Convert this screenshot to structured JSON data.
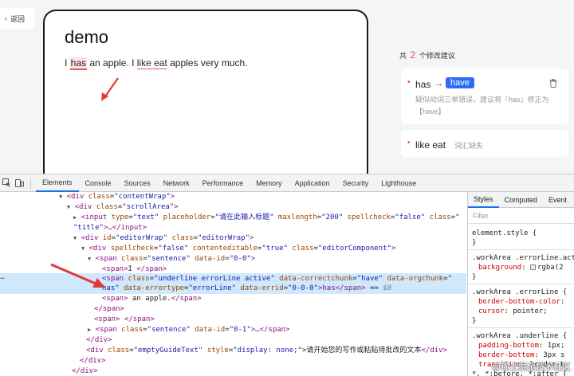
{
  "app": {
    "back_label": "返回",
    "editor_title": "demo",
    "text": {
      "pre": "I ",
      "has": "has",
      "mid": " an apple. I ",
      "like_eat": "like eat",
      "post": " apples very much."
    }
  },
  "suggestions": {
    "count_pre": "共",
    "count_num": "2",
    "count_post": "个修改建议",
    "items": [
      {
        "word": "has",
        "arrow": "→",
        "replacement": "have",
        "desc": "疑似动词三单错误，建议将『has』修正为【have】"
      },
      {
        "word": "like eat",
        "note": "词汇缺失"
      }
    ]
  },
  "devtools": {
    "tabs": [
      "Elements",
      "Console",
      "Sources",
      "Network",
      "Performance",
      "Memory",
      "Application",
      "Security",
      "Lighthouse"
    ],
    "active_tab": "Elements",
    "styles_tabs": [
      "Styles",
      "Computed",
      "Event"
    ],
    "filter_placeholder": "Filter",
    "dom": {
      "l1": {
        "open": "<div ",
        "a1": "class",
        "v1": "\"contentWrap\"",
        "close": ">"
      },
      "l2": {
        "open": "<div ",
        "a1": "class",
        "v1": "\"scrollArea\"",
        "close": ">"
      },
      "l3": {
        "open": "<input ",
        "a1": "type",
        "v1": "\"text\"",
        "a2": "placeholder",
        "v2": "\"请在此输入标题\"",
        "a3": "maxlength",
        "v3": "\"200\"",
        "a4": "spellcheck",
        "v4": "\"false\"",
        "a5": "class",
        "v5": "\""
      },
      "l4": {
        "v": "\"title\"",
        "close": ">…</input>"
      },
      "l5": {
        "open": "<div ",
        "a1": "id",
        "v1": "\"editorWrap\"",
        "a2": "class",
        "v2": "\"editorWrap\"",
        "close": ">"
      },
      "l6": {
        "open": "<div ",
        "a1": "spellcheck",
        "v1": "\"false\"",
        "a2": "contenteditable",
        "v2": "\"true\"",
        "a3": "class",
        "v3": "\"editorComponent\"",
        "close": ">"
      },
      "l7": {
        "open": "<span ",
        "a1": "class",
        "v1": "\"sentence\"",
        "a2": "data-id",
        "v2": "\"0-0\"",
        "close": ">"
      },
      "l8": {
        "open": "<span>",
        "text": "I ",
        "close": "</span>"
      },
      "l9": {
        "open": "<span ",
        "a1": "class",
        "v1": "\"underline errorLine active\"",
        "a2": "data-correctchunk",
        "v2": "\"have\"",
        "a3": "data-orgchunk",
        "v3": "\""
      },
      "l10": {
        "v": "has\"",
        "a1": "data-errortype",
        "v1": "\"errorLine\"",
        "a2": "data-errid",
        "v2": "\"0-0-0\"",
        "close": ">has</span>",
        "eq": " == ",
        "dollar": "$0"
      },
      "l11": {
        "open": "<span>",
        "text": " an apple.",
        "close": "</span>"
      },
      "l12": {
        "close": "</span>"
      },
      "l13": {
        "close": "<span> </span>"
      },
      "l14": {
        "open": "<span ",
        "a1": "class",
        "v1": "\"sentence\"",
        "a2": "data-id",
        "v2": "\"0-1\"",
        "close": ">…</span>"
      },
      "l15": {
        "close": "</div>"
      },
      "l16": {
        "open": "<div ",
        "a1": "class",
        "v1": "\"emptyGuideText\"",
        "a2": "style",
        "v2": "\"display: none;\"",
        "text": ">请开始您的写作或粘贴待批改的文本",
        "close": "</div>"
      },
      "l17": {
        "close": "</div>"
      },
      "l18": {
        "close": "</div>"
      }
    },
    "styles": {
      "s1": "element.style {",
      "s2": "}",
      "s3": ".workArea .errorLine.act",
      "s4p": "background",
      "s4v": "rgba(2",
      "s5": "}",
      "s6": ".workArea .errorLine {",
      "s7p": "border-bottom-color",
      "s7v": "",
      "s8p": "cursor",
      "s8v": "pointer;",
      "s9": "}",
      "s10": ".workArea .underline {",
      "s11p": "padding-bottom",
      "s11v": "1px;",
      "s12p": "border-bottom",
      "s12v": "3px s",
      "s13p": "transition",
      "s13v": "border-b",
      "s14": "*, *:before, *:after {"
    },
    "watermark": "@稀土掘金技术社区"
  },
  "colors": {
    "accent": "#2c6cf6",
    "error": "#e54545",
    "selected": "#cfe8fc"
  }
}
